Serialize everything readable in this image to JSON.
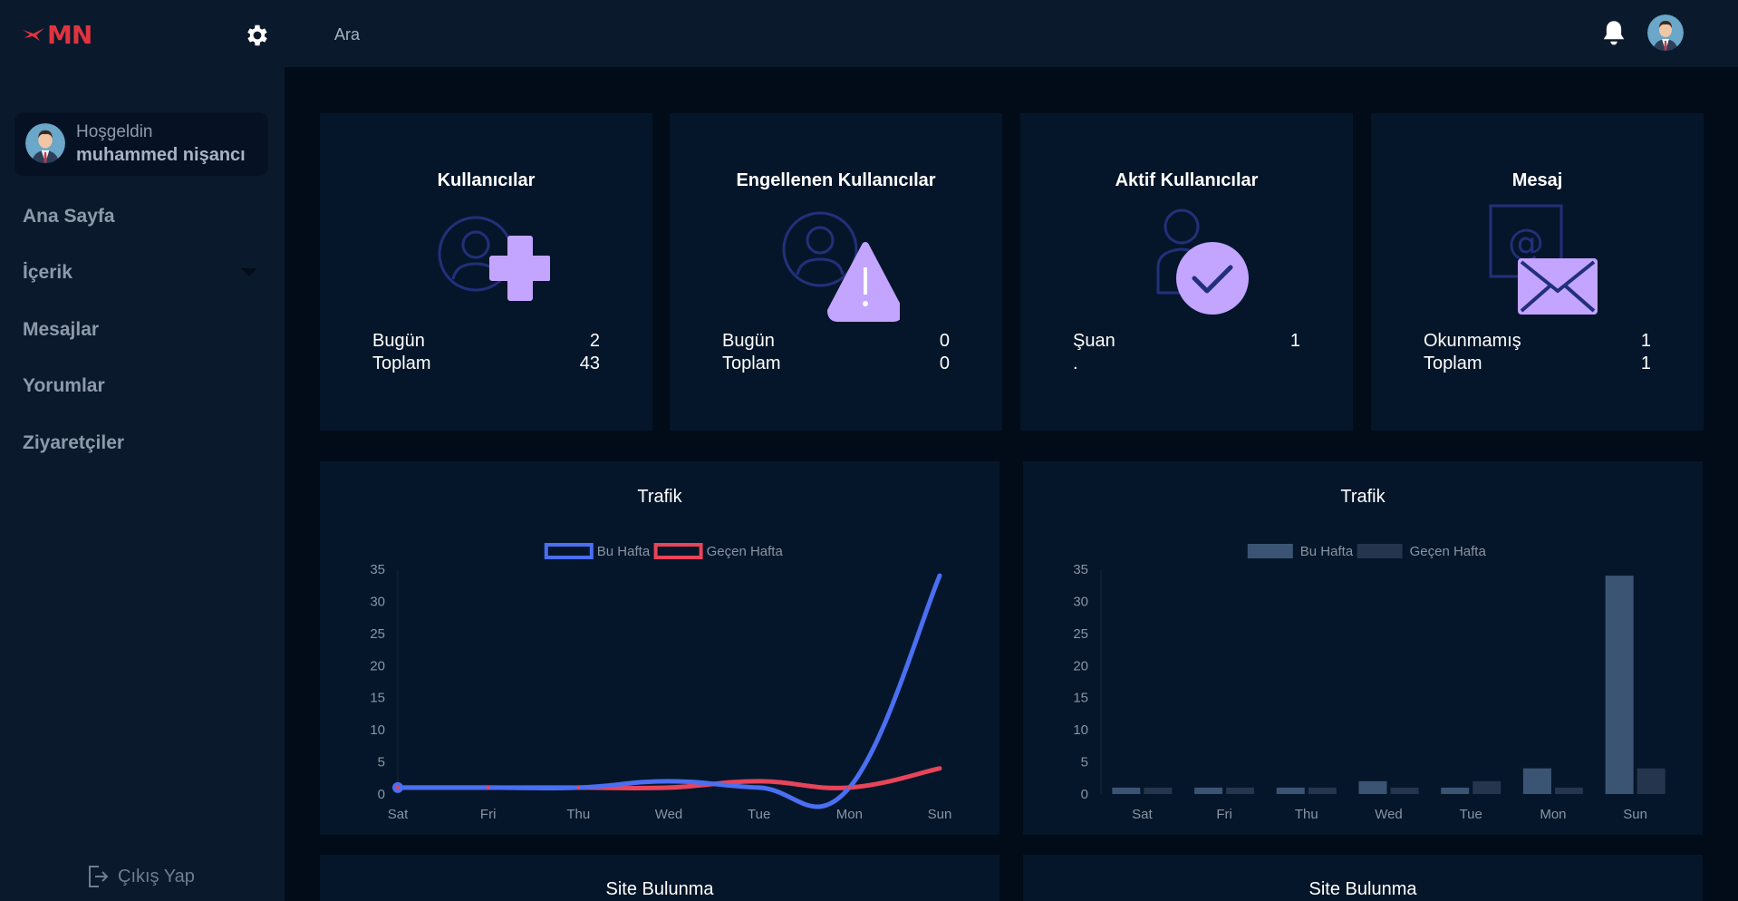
{
  "brand": {
    "logo_text": "MN"
  },
  "topbar": {
    "search_placeholder": "Ara"
  },
  "sidebar": {
    "welcome_label": "Hoşgeldin",
    "user_name": "muhammed nişancı",
    "items": [
      {
        "label": "Ana Sayfa"
      },
      {
        "label": "İçerik"
      },
      {
        "label": "Mesajlar"
      },
      {
        "label": "Yorumlar"
      },
      {
        "label": "Ziyaretçiler"
      }
    ],
    "logout_label": "Çıkış Yap"
  },
  "stats": [
    {
      "title": "Kullanıcılar",
      "icon": "user-add-icon",
      "rows": [
        {
          "label": "Bugün",
          "value": "2"
        },
        {
          "label": "Toplam",
          "value": "43"
        }
      ]
    },
    {
      "title": "Engellenen Kullanıcılar",
      "icon": "user-blocked-icon",
      "rows": [
        {
          "label": "Bugün",
          "value": "0"
        },
        {
          "label": "Toplam",
          "value": "0"
        }
      ]
    },
    {
      "title": "Aktif Kullanıcılar",
      "icon": "user-active-icon",
      "rows": [
        {
          "label": "Şuan",
          "value": "1"
        },
        {
          "label": ".",
          "value": ""
        }
      ]
    },
    {
      "title": "Mesaj",
      "icon": "mail-icon",
      "rows": [
        {
          "label": "Okunmamış",
          "value": "1"
        },
        {
          "label": "Toplam",
          "value": "1"
        }
      ]
    }
  ],
  "colors": {
    "accent_purple": "#c3a4ff",
    "line_this_week": "#4b6ff2",
    "line_last_week": "#e8445a",
    "bar_this_week": "#3b5473",
    "bar_last_week": "#25354d"
  },
  "chart_data": [
    {
      "type": "line",
      "title": "Trafik",
      "categories": [
        "Sat",
        "Fri",
        "Thu",
        "Wed",
        "Tue",
        "Mon",
        "Sun"
      ],
      "series": [
        {
          "name": "Bu Hafta",
          "values": [
            1,
            1,
            1,
            2,
            1,
            1,
            34
          ]
        },
        {
          "name": "Geçen Hafta",
          "values": [
            1,
            1,
            1,
            1,
            2,
            1,
            4
          ]
        }
      ],
      "ylim": [
        0,
        35
      ],
      "yticks": [
        0,
        5,
        10,
        15,
        20,
        25,
        30,
        35
      ],
      "legend": "top-center"
    },
    {
      "type": "bar",
      "title": "Trafik",
      "categories": [
        "Sat",
        "Fri",
        "Thu",
        "Wed",
        "Tue",
        "Mon",
        "Sun"
      ],
      "series": [
        {
          "name": "Bu Hafta",
          "values": [
            1,
            1,
            1,
            2,
            1,
            4,
            34
          ]
        },
        {
          "name": "Geçen Hafta",
          "values": [
            1,
            1,
            1,
            1,
            2,
            1,
            4
          ]
        }
      ],
      "ylim": [
        0,
        35
      ],
      "yticks": [
        0,
        5,
        10,
        15,
        20,
        25,
        30,
        35
      ],
      "legend": "top-center"
    }
  ],
  "bottom_cards": [
    {
      "title": "Site Bulunma"
    },
    {
      "title": "Site Bulunma"
    }
  ]
}
